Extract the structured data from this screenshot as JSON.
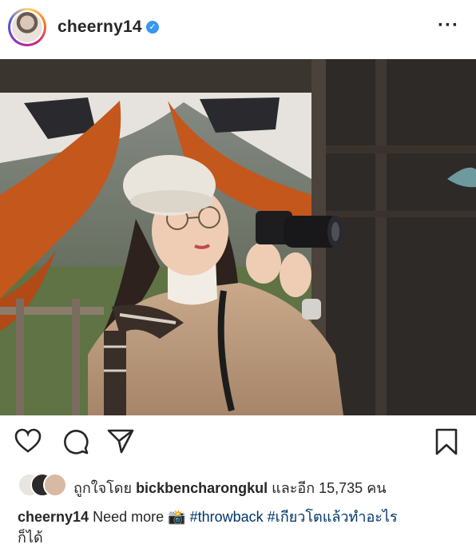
{
  "header": {
    "username": "cheerny14",
    "verified": true,
    "more_icon": "ellipsis-icon"
  },
  "photo": {
    "description_icon": "photo"
  },
  "actions": {
    "icons": [
      "heart-icon",
      "comment-icon",
      "share-icon",
      "bookmark-icon"
    ]
  },
  "likes": {
    "prefix": "ถูกใจโดย",
    "user": "bickbencharongkul",
    "suffix": "และอีก 15,735 คน"
  },
  "caption": {
    "username": "cheerny14",
    "text_start": "Need more",
    "emoji": "📸",
    "hashtag1": "#throwback",
    "hashtag2": "#เกียวโตแล้วทำอะไร",
    "text_end": "ก็ได้"
  },
  "colors": {
    "text": "#262626",
    "verified": "#3897f0",
    "hashtag": "#003569"
  }
}
